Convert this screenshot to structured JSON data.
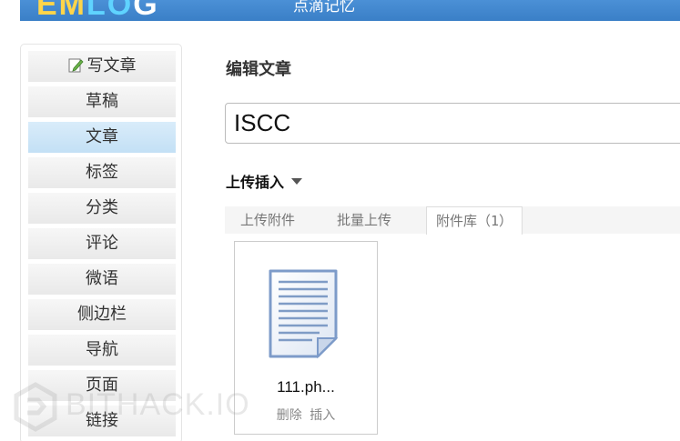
{
  "header": {
    "logo": [
      "EM",
      "LO",
      "G"
    ],
    "site_name": "点滴记忆"
  },
  "sidebar": {
    "items": [
      {
        "label": "写文章",
        "icon": "pencil-icon"
      },
      {
        "label": "草稿"
      },
      {
        "label": "文章",
        "active": true
      },
      {
        "label": "标签"
      },
      {
        "label": "分类"
      },
      {
        "label": "评论"
      },
      {
        "label": "微语"
      },
      {
        "label": "侧边栏"
      },
      {
        "label": "导航"
      },
      {
        "label": "页面"
      },
      {
        "label": "链接"
      }
    ]
  },
  "main": {
    "page_title": "编辑文章",
    "title_value": "ISCC",
    "upload_section_label": "上传插入",
    "tabs": [
      {
        "label": "上传附件"
      },
      {
        "label": "批量上传"
      },
      {
        "label": "附件库（1）",
        "active": true
      }
    ],
    "attachment": {
      "name": "111.ph...",
      "icon": "document-icon",
      "delete_label": "删除",
      "insert_label": "插入"
    }
  },
  "watermark": "BITHACK.IO",
  "colors": {
    "header": "#3a7fc7",
    "active_nav": "#c3e0f5"
  }
}
